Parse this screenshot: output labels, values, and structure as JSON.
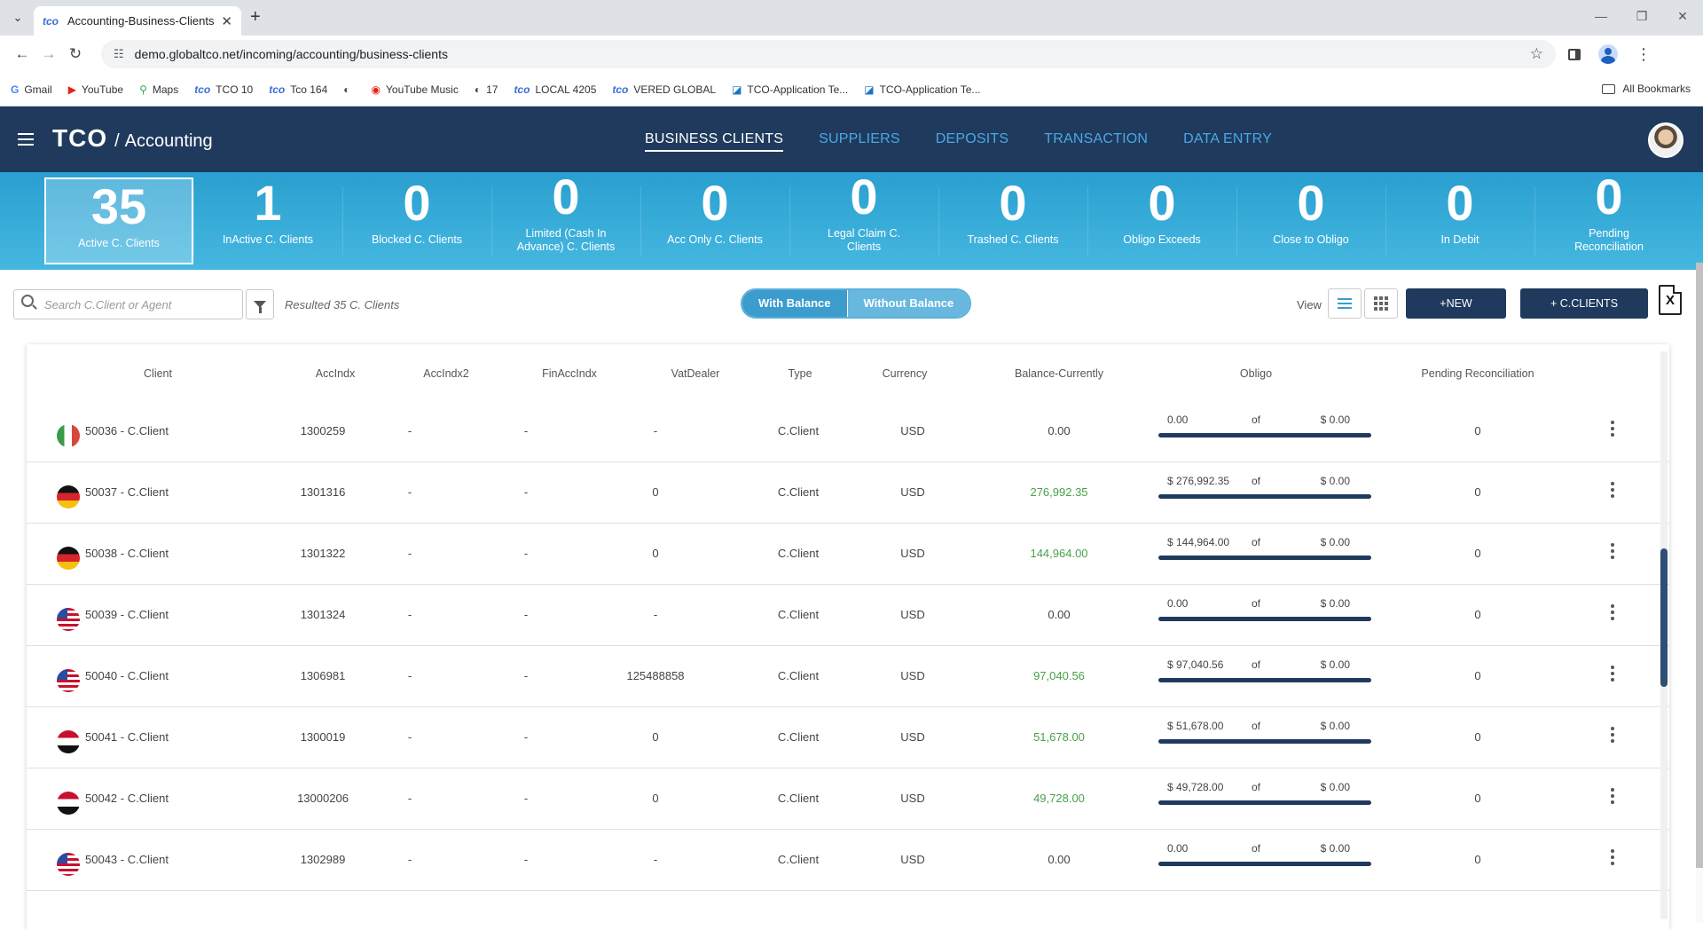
{
  "browser": {
    "tab_title": "Accounting-Business-Clients",
    "favicon": "tco",
    "url": "demo.globaltco.net/incoming/accounting/business-clients",
    "bookmarks": [
      {
        "label": "Gmail",
        "icon": "G",
        "color": "#4285f4"
      },
      {
        "label": "YouTube",
        "icon": "▶",
        "color": "#e62117"
      },
      {
        "label": "Maps",
        "icon": "⚲",
        "color": "#34a853"
      },
      {
        "label": "TCO 10",
        "icon": "tco",
        "color": "#3c6fd6"
      },
      {
        "label": "Tco 164",
        "icon": "tco",
        "color": "#3c6fd6"
      },
      {
        "label": "",
        "icon": "◐",
        "color": "#444"
      },
      {
        "label": "YouTube Music",
        "icon": "◉",
        "color": "#e62117"
      },
      {
        "label": "17",
        "icon": "◐",
        "color": "#444"
      },
      {
        "label": "LOCAL 4205",
        "icon": "tco",
        "color": "#3c6fd6"
      },
      {
        "label": "VERED GLOBAL",
        "icon": "tco",
        "color": "#3c6fd6"
      },
      {
        "label": "TCO-Application Te...",
        "icon": "◪",
        "color": "#1a73c8"
      },
      {
        "label": "TCO-Application Te...",
        "icon": "◪",
        "color": "#1a73c8"
      }
    ],
    "all_bookmarks": "All Bookmarks"
  },
  "header": {
    "brand": "TCO",
    "slash": "/",
    "section": "Accounting",
    "nav": [
      {
        "label": "BUSINESS CLIENTS",
        "active": true
      },
      {
        "label": "SUPPLIERS",
        "active": false
      },
      {
        "label": "DEPOSITS",
        "active": false
      },
      {
        "label": "TRANSACTION",
        "active": false
      },
      {
        "label": "DATA ENTRY",
        "active": false
      }
    ]
  },
  "stats": [
    {
      "num": "35",
      "label": "Active C. Clients",
      "active": true
    },
    {
      "num": "1",
      "label": "InActive C. Clients"
    },
    {
      "num": "0",
      "label": "Blocked C. Clients"
    },
    {
      "num": "0",
      "label": "Limited (Cash In Advance) C. Clients",
      "tall": true
    },
    {
      "num": "0",
      "label": "Acc Only C. Clients"
    },
    {
      "num": "0",
      "label": "Legal Claim C. Clients",
      "tall": true
    },
    {
      "num": "0",
      "label": "Trashed C. Clients"
    },
    {
      "num": "0",
      "label": "Obligo Exceeds"
    },
    {
      "num": "0",
      "label": "Close to Obligo"
    },
    {
      "num": "0",
      "label": "In Debit"
    },
    {
      "num": "0",
      "label": "Pending Reconciliation",
      "tall": true
    }
  ],
  "toolbar": {
    "search_placeholder": "Search C.Client or Agent",
    "resulted": "Resulted 35 C. Clients",
    "with_balance": "With Balance",
    "without_balance": "Without Balance",
    "view_label": "View",
    "new_client": "+NEW C.CLIENT",
    "clients_groups": "+ C.CLIENTS GROUPS",
    "export_icon": "X"
  },
  "table": {
    "columns": [
      "Client",
      "AccIndx",
      "AccIndx2",
      "FinAccIndx",
      "VatDealer",
      "Type",
      "Currency",
      "Balance-Currently",
      "Obligo",
      "Pending Reconciliation"
    ],
    "rows": [
      {
        "flag": "it",
        "client": "50036 - C.Client",
        "accindx": "1300259",
        "accindx2": "-",
        "finaccindx": "-",
        "vatdealer": "-",
        "type": "C.Client",
        "currency": "USD",
        "balance": "0.00",
        "balance_positive": false,
        "obligo_used": "0.00",
        "obligo_of": "of",
        "obligo_max": "$ 0.00",
        "pending": "0"
      },
      {
        "flag": "de",
        "client": "50037 - C.Client",
        "accindx": "1301316",
        "accindx2": "-",
        "finaccindx": "-",
        "vatdealer": "0",
        "type": "C.Client",
        "currency": "USD",
        "balance": "276,992.35",
        "balance_positive": true,
        "obligo_used": "$ 276,992.35",
        "obligo_of": "of",
        "obligo_max": "$ 0.00",
        "pending": "0"
      },
      {
        "flag": "de",
        "client": "50038 - C.Client",
        "accindx": "1301322",
        "accindx2": "-",
        "finaccindx": "-",
        "vatdealer": "0",
        "type": "C.Client",
        "currency": "USD",
        "balance": "144,964.00",
        "balance_positive": true,
        "obligo_used": "$ 144,964.00",
        "obligo_of": "of",
        "obligo_max": "$ 0.00",
        "pending": "0"
      },
      {
        "flag": "us",
        "client": "50039 - C.Client",
        "accindx": "1301324",
        "accindx2": "-",
        "finaccindx": "-",
        "vatdealer": "-",
        "type": "C.Client",
        "currency": "USD",
        "balance": "0.00",
        "balance_positive": false,
        "obligo_used": "0.00",
        "obligo_of": "of",
        "obligo_max": "$ 0.00",
        "pending": "0"
      },
      {
        "flag": "us",
        "client": "50040 - C.Client",
        "accindx": "1306981",
        "accindx2": "-",
        "finaccindx": "-",
        "vatdealer": "125488858",
        "type": "C.Client",
        "currency": "USD",
        "balance": "97,040.56",
        "balance_positive": true,
        "obligo_used": "$ 97,040.56",
        "obligo_of": "of",
        "obligo_max": "$ 0.00",
        "pending": "0"
      },
      {
        "flag": "eg",
        "client": "50041 - C.Client",
        "accindx": "1300019",
        "accindx2": "-",
        "finaccindx": "-",
        "vatdealer": "0",
        "type": "C.Client",
        "currency": "USD",
        "balance": "51,678.00",
        "balance_positive": true,
        "obligo_used": "$ 51,678.00",
        "obligo_of": "of",
        "obligo_max": "$ 0.00",
        "pending": "0"
      },
      {
        "flag": "eg",
        "client": "50042 - C.Client",
        "accindx": "13000206",
        "accindx2": "-",
        "finaccindx": "-",
        "vatdealer": "0",
        "type": "C.Client",
        "currency": "USD",
        "balance": "49,728.00",
        "balance_positive": true,
        "obligo_used": "$ 49,728.00",
        "obligo_of": "of",
        "obligo_max": "$ 0.00",
        "pending": "0"
      },
      {
        "flag": "us",
        "client": "50043 - C.Client",
        "accindx": "1302989",
        "accindx2": "-",
        "finaccindx": "-",
        "vatdealer": "-",
        "type": "C.Client",
        "currency": "USD",
        "balance": "0.00",
        "balance_positive": false,
        "obligo_used": "0.00",
        "obligo_of": "of",
        "obligo_max": "$ 0.00",
        "pending": "0"
      }
    ]
  }
}
